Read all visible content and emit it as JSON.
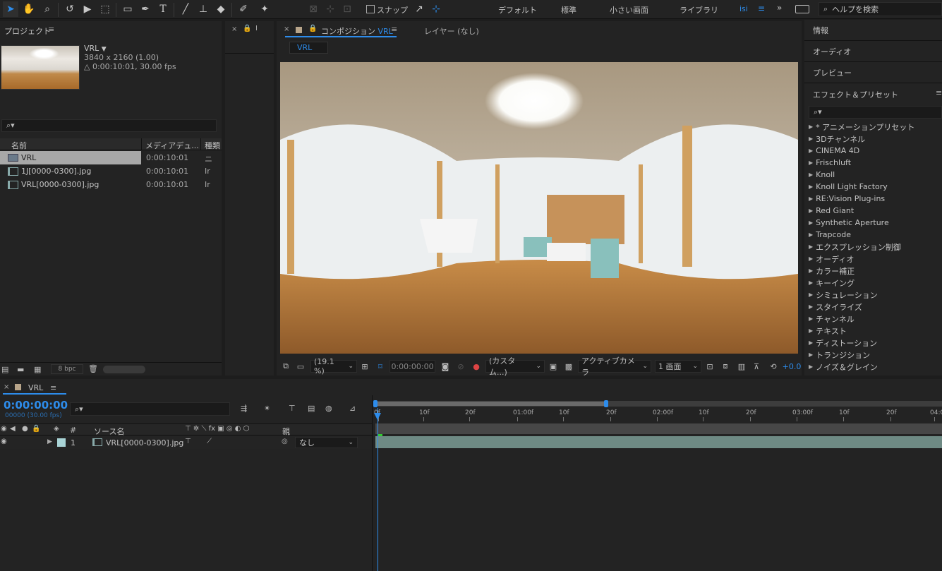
{
  "toolbar": {
    "snap_label": "スナップ",
    "workspaces": [
      "デフォルト",
      "標準",
      "小さい画面",
      "ライブラリ",
      "isi"
    ],
    "search_placeholder": "ヘルプを検索"
  },
  "project": {
    "title": "プロジェクト",
    "comp_name": "VRL",
    "comp_dims": "3840 x 2160 (1.00)",
    "comp_duration": "△ 0:00:10:01, 30.00 fps",
    "search_icon": "⌕▾",
    "columns": [
      "名前",
      "メディアデュ...",
      "種類"
    ],
    "items": [
      {
        "name": "VRL",
        "duration": "0:00:10:01",
        "type": "ニ"
      },
      {
        "name": "1J[0000-0300].jpg",
        "duration": "0:00:10:01",
        "type": "Ir"
      },
      {
        "name": "VRL[0000-0300].jpg",
        "duration": "0:00:10:01",
        "type": "Ir"
      }
    ],
    "bpc": "8 bpc"
  },
  "composition": {
    "tab_label": "コンポジション",
    "tab_name": "VRL",
    "layer_tab": "レイヤー (なし)",
    "flow_tab": "VRL",
    "zoom": "(19.1 %)",
    "timecode": "0:00:00:00",
    "channel": "(カスタム...)",
    "camera": "アクティブカメラ",
    "views": "1 画面",
    "exposure": "+0.0"
  },
  "right": {
    "sections": [
      "情報",
      "オーディオ",
      "プレビュー",
      "エフェクト＆プリセット"
    ],
    "search_icon": "⌕▾",
    "effects": [
      "* アニメーションプリセット",
      "3Dチャンネル",
      "CINEMA 4D",
      "Frischluft",
      "Knoll",
      "Knoll Light Factory",
      "RE:Vision Plug-ins",
      "Red Giant",
      "Synthetic Aperture",
      "Trapcode",
      "エクスプレッション制御",
      "オーディオ",
      "カラー補正",
      "キーイング",
      "シミュレーション",
      "スタイライズ",
      "チャンネル",
      "テキスト",
      "ディストーション",
      "トランジション",
      "ノイズ＆グレイン"
    ]
  },
  "timeline": {
    "comp_tab": "VRL",
    "timecode": "0:00:00:00",
    "frame_info": "00000 (30.00 fps)",
    "search_icon": "⌕▾",
    "col_num": "#",
    "col_source": "ソース名",
    "col_parent": "親",
    "layer": {
      "index": "1",
      "name": "VRL[0000-0300].jpg",
      "parent": "なし"
    },
    "ruler": [
      "0f",
      "10f",
      "20f",
      "01:00f",
      "10f",
      "20f",
      "02:00f",
      "10f",
      "20f",
      "03:00f",
      "10f",
      "20f",
      "04:0"
    ]
  },
  "colors": {
    "accent": "#2d8ceb",
    "bg": "#1d1d1d",
    "panel": "#232323",
    "layer_bar": "#6e8a84",
    "label_swatch": "#a9d4d6"
  }
}
